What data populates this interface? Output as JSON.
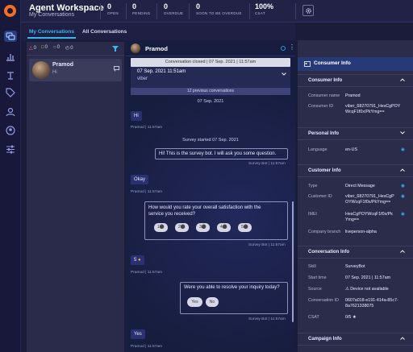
{
  "app": {
    "title": "Agent Workspace",
    "subtitle": "My Conversations"
  },
  "stats": [
    {
      "value": "0",
      "label": "OPEN"
    },
    {
      "value": "0",
      "label": "PENDING"
    },
    {
      "value": "0",
      "label": "OVERDUE"
    },
    {
      "value": "0",
      "label": "SOON TO BE OVERDUE"
    },
    {
      "value": "100%",
      "label": "CSAT"
    }
  ],
  "tabs": {
    "my": "My Conversations",
    "all": "All Conversations"
  },
  "filters": [
    "0",
    "0",
    "0",
    "0"
  ],
  "conversation_item": {
    "name": "Pramod",
    "snippet": "Hi"
  },
  "chat": {
    "header_name": "Pramod",
    "closed_banner": "Conversation closed | 07 Sep. 2021 | 11:57am",
    "previous": {
      "date": "07 Sep. 2021 11:51am",
      "source": "viber"
    },
    "previous_count": "12 previous conversations",
    "date_separator": "07 Sep. 2021",
    "survey_started": "Survey started 07 Sep. 2021",
    "messages": [
      {
        "text": "Hi",
        "meta": "Pramod | 11:57am"
      },
      {
        "text": "Hi! This is the survey bot. I will ask you some question.",
        "meta": "Survey Bot | 11:57am"
      },
      {
        "text": "Okay",
        "meta": "Pramod | 11:57am"
      },
      {
        "text": "How would you rate your overall satisfaction with the service you received?",
        "meta": "Survey Bot | 11:57am"
      },
      {
        "text": "5",
        "meta": "Pramod | 11:57am"
      },
      {
        "text": "Were you able to resolve your inquiry today?",
        "meta": "Survey Bot | 11:57am"
      },
      {
        "text": "Yes",
        "meta": "Pramod | 11:57am"
      }
    ],
    "rating_options": [
      "1",
      "2",
      "3",
      "4",
      "5"
    ],
    "yn_options": [
      "Yes",
      "No"
    ]
  },
  "toolbar": {
    "qr": "QR"
  },
  "consumer_info": {
    "title": "Consumer Info",
    "sections": {
      "consumer": {
        "title": "Consumer Info",
        "name_label": "Consumer name",
        "name": "Pramod",
        "id_label": "Consumer ID",
        "id": "viber_68270791_HesCgPOYWcqF1f0x/PkYmg=="
      },
      "personal": {
        "title": "Personal Info",
        "lang_label": "Language",
        "lang": "en-US"
      },
      "customer": {
        "title": "Customer Info",
        "type_label": "Type",
        "type": "Direct Message",
        "cid_label": "Customer ID",
        "cid": "viber_68270791_HesCgPOYWcqF1f0x/PkYmg==",
        "imei_label": "IMEI",
        "imei": "HesCgPOYWcqF1f0x/PkYmg==",
        "branch_label": "Company branch",
        "branch": "liveperson-alpha"
      },
      "conversation": {
        "title": "Conversation Info",
        "skill_label": "Skill",
        "skill": "SurveyBot",
        "start_label": "Start time",
        "start": "07 Sep. 2021 | 11:57am",
        "source_label": "Source",
        "source": "Device not available",
        "convid_label": "Conversation ID",
        "convid": "0607a018-e191-414a-85c7-8a7621338075",
        "csat_label": "CSAT",
        "csat": "0/5"
      },
      "campaign": {
        "title": "Campaign Info"
      }
    }
  },
  "colors": {
    "accent": "#38b6f0",
    "brand": "#f46f20",
    "agent_bubble": "#2a3170",
    "panel": "#2b2b4a"
  }
}
